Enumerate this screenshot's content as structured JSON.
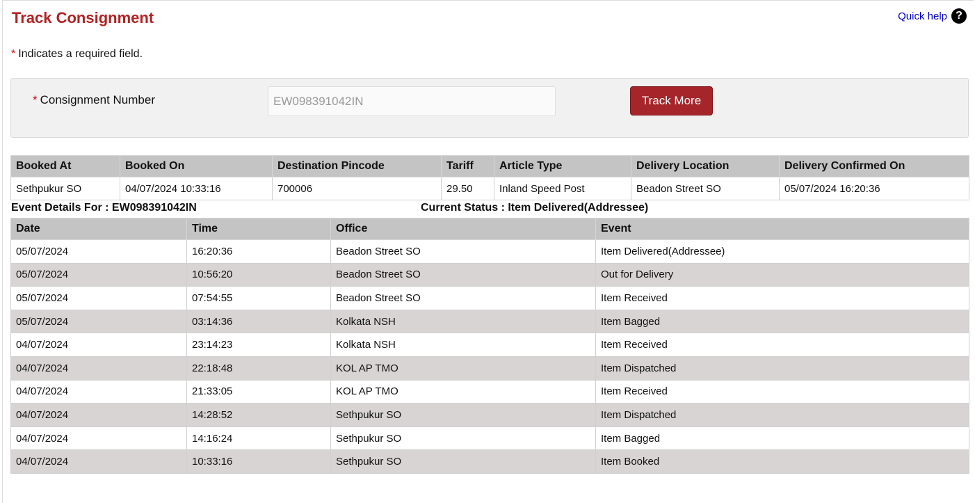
{
  "page": {
    "title": "Track Consignment",
    "quick_help": "Quick help",
    "help_icon": "?"
  },
  "required_note": {
    "star": "*",
    "text": "Indicates a required field."
  },
  "form": {
    "label_star": "*",
    "label": "Consignment Number",
    "consignment_value": "EW098391042IN",
    "track_button": "Track More"
  },
  "booking": {
    "headers": [
      "Booked At",
      "Booked On",
      "Destination Pincode",
      "Tariff",
      "Article Type",
      "Delivery Location",
      "Delivery Confirmed On"
    ],
    "row": [
      "Sethpukur SO",
      "04/07/2024 10:33:16",
      "700006",
      "29.50",
      "Inland Speed Post",
      "Beadon Street SO",
      "05/07/2024 16:20:36"
    ]
  },
  "event_details": {
    "label": "Event Details For : EW098391042IN",
    "status": "Current Status : Item Delivered(Addressee)"
  },
  "events": {
    "headers": [
      "Date",
      "Time",
      "Office",
      "Event"
    ],
    "rows": [
      [
        "05/07/2024",
        "16:20:36",
        "Beadon Street SO",
        "Item Delivered(Addressee)"
      ],
      [
        "05/07/2024",
        "10:56:20",
        "Beadon Street SO",
        "Out for Delivery"
      ],
      [
        "05/07/2024",
        "07:54:55",
        "Beadon Street SO",
        "Item Received"
      ],
      [
        "05/07/2024",
        "03:14:36",
        "Kolkata NSH",
        "Item Bagged"
      ],
      [
        "04/07/2024",
        "23:14:23",
        "Kolkata NSH",
        "Item Received"
      ],
      [
        "04/07/2024",
        "22:18:48",
        "KOL AP TMO",
        "Item Dispatched"
      ],
      [
        "04/07/2024",
        "21:33:05",
        "KOL AP TMO",
        "Item Received"
      ],
      [
        "04/07/2024",
        "14:28:52",
        "Sethpukur SO",
        "Item Dispatched"
      ],
      [
        "04/07/2024",
        "14:16:24",
        "Sethpukur SO",
        "Item Bagged"
      ],
      [
        "04/07/2024",
        "10:33:16",
        "Sethpukur SO",
        "Item Booked"
      ]
    ]
  },
  "colors": {
    "title": "#b22222",
    "button": "#a5252a",
    "link": "#0000cc",
    "header_bg": "#c4c4c4",
    "row_alt_bg": "#d8d4d4"
  }
}
